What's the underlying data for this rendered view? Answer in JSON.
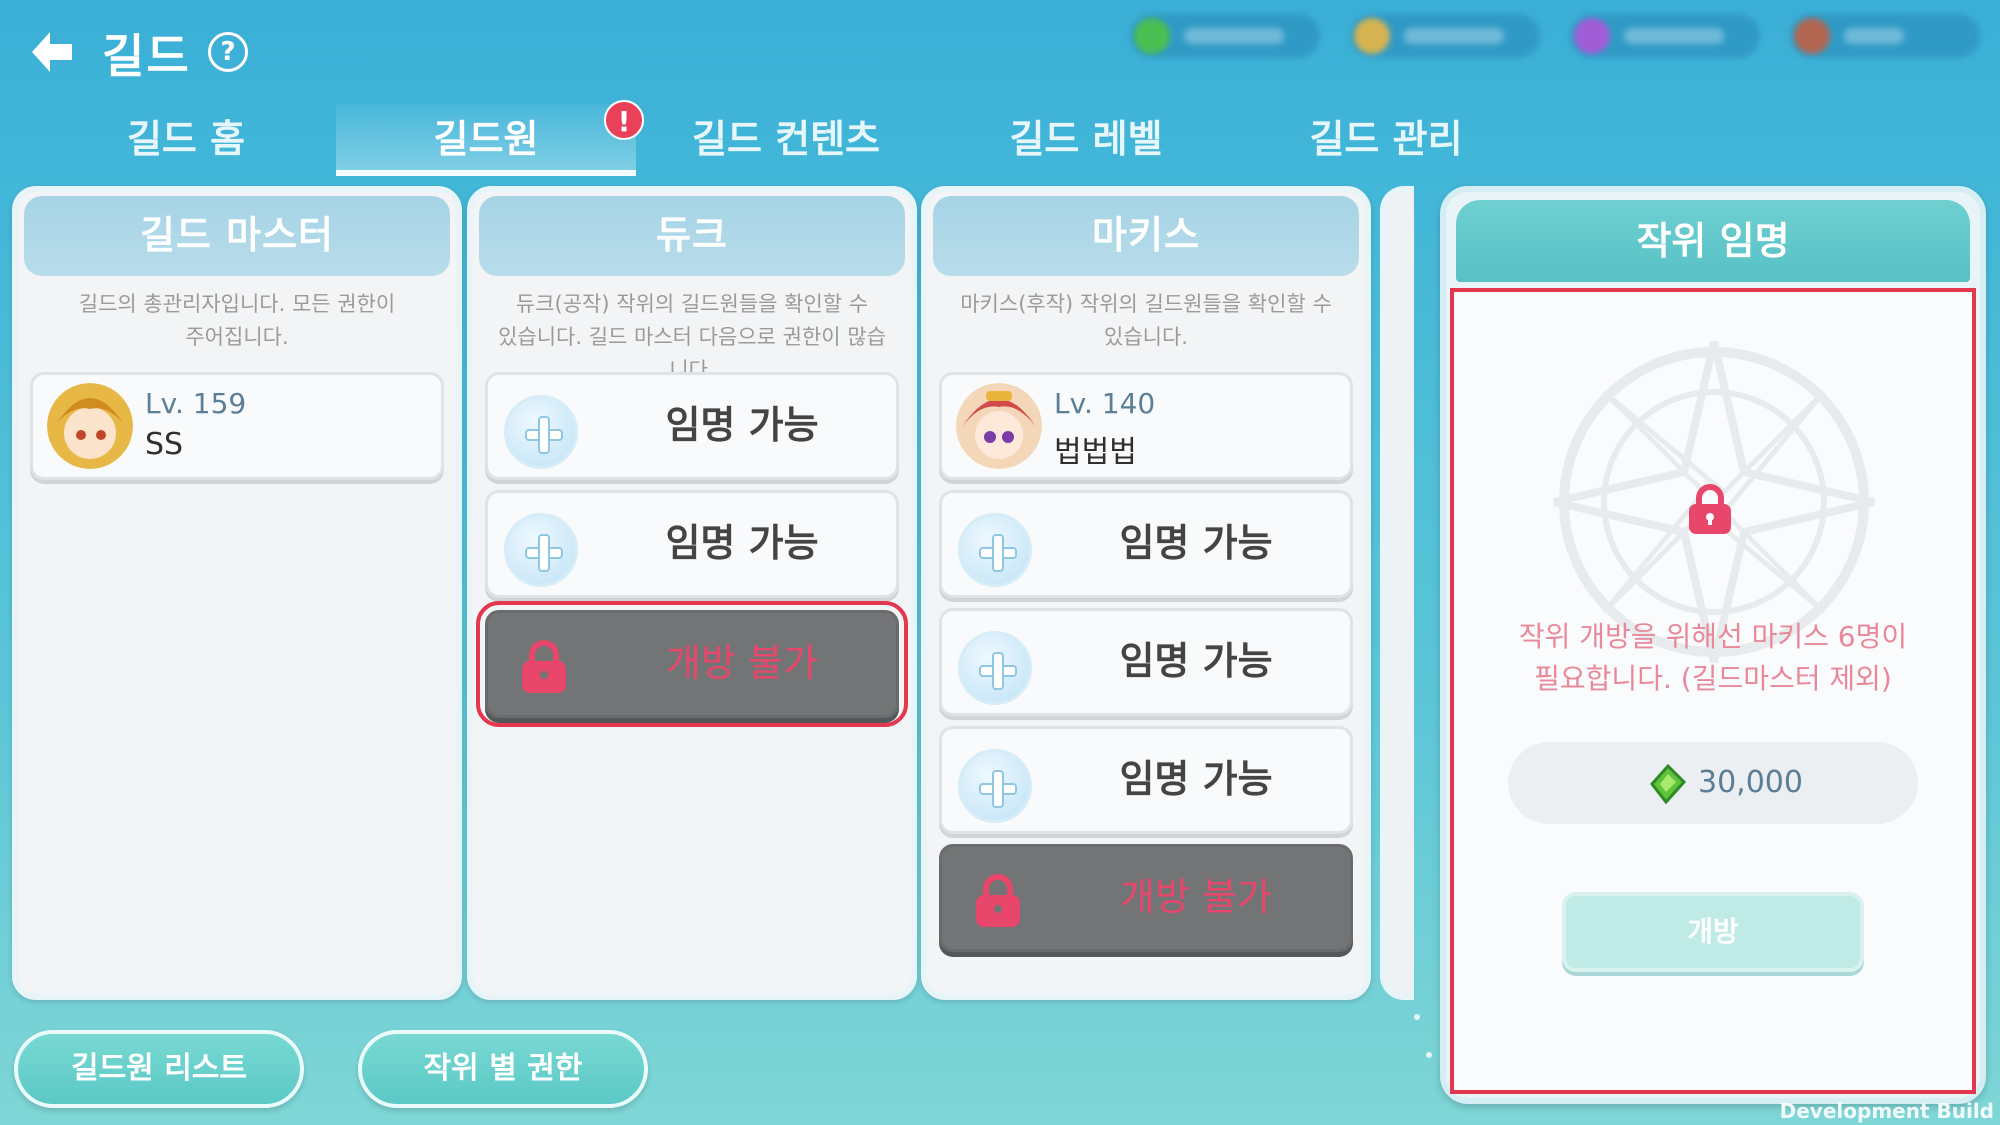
{
  "header": {
    "back_icon": "back-arrow-icon",
    "title": "길드",
    "help_label": "?",
    "help_icon": "question-icon"
  },
  "currencies": [
    {
      "icon": "green-gem-icon",
      "color": "#4cc23a"
    },
    {
      "icon": "gold-coin-icon",
      "color": "#f0b43a"
    },
    {
      "icon": "purple-gem-icon",
      "color": "#b34fd6"
    },
    {
      "icon": "red-orb-icon",
      "color": "#c85a3a"
    }
  ],
  "tabs": [
    {
      "label": "길드 홈",
      "active": false
    },
    {
      "label": "길드원",
      "active": true,
      "badge": "!"
    },
    {
      "label": "길드 컨텐츠",
      "active": false
    },
    {
      "label": "길드 레벨",
      "active": false
    },
    {
      "label": "길드 관리",
      "active": false
    }
  ],
  "columns": [
    {
      "title": "길드 마스터",
      "desc_lines": [
        "길드의 총관리자입니다. 모든 권한이",
        "주어집니다."
      ],
      "slots": [
        {
          "type": "member",
          "level": "Lv. 159",
          "name": "SS"
        }
      ]
    },
    {
      "title": "듀크",
      "desc_lines": [
        "듀크(공작) 작위의 길드원들을 확인할 수",
        "있습니다. 길드 마스터 다음으로 권한이 많습니다."
      ],
      "slots": [
        {
          "type": "open",
          "label": "임명 가능"
        },
        {
          "type": "open",
          "label": "임명 가능"
        },
        {
          "type": "locked",
          "label": "개방 불가",
          "selected": true
        }
      ]
    },
    {
      "title": "마키스",
      "desc_lines": [
        "마키스(후작) 작위의 길드원들을 확인할 수",
        "있습니다."
      ],
      "slots": [
        {
          "type": "member",
          "level": "Lv. 140",
          "name": "법법법"
        },
        {
          "type": "open",
          "label": "임명 가능"
        },
        {
          "type": "open",
          "label": "임명 가능"
        },
        {
          "type": "open",
          "label": "임명 가능"
        },
        {
          "type": "locked",
          "label": "개방 불가"
        }
      ]
    }
  ],
  "panel": {
    "title": "작위 임명",
    "message_lines": [
      "작위 개방을 위해선 마키스 6명이",
      "필요합니다. (길드마스터 제외)"
    ],
    "cost_icon": "green-gem-icon",
    "cost": "30,000",
    "open_label": "개방",
    "lock_icon": "lock-icon"
  },
  "bottom": {
    "member_list_label": "길드원 리스트",
    "rank_permissions_label": "작위 별 권한"
  },
  "footer": {
    "dev_build": "Development Build"
  },
  "colors": {
    "accent_red": "#e2374f",
    "locked_text": "#e8476b",
    "teal": "#5cc9c6"
  }
}
